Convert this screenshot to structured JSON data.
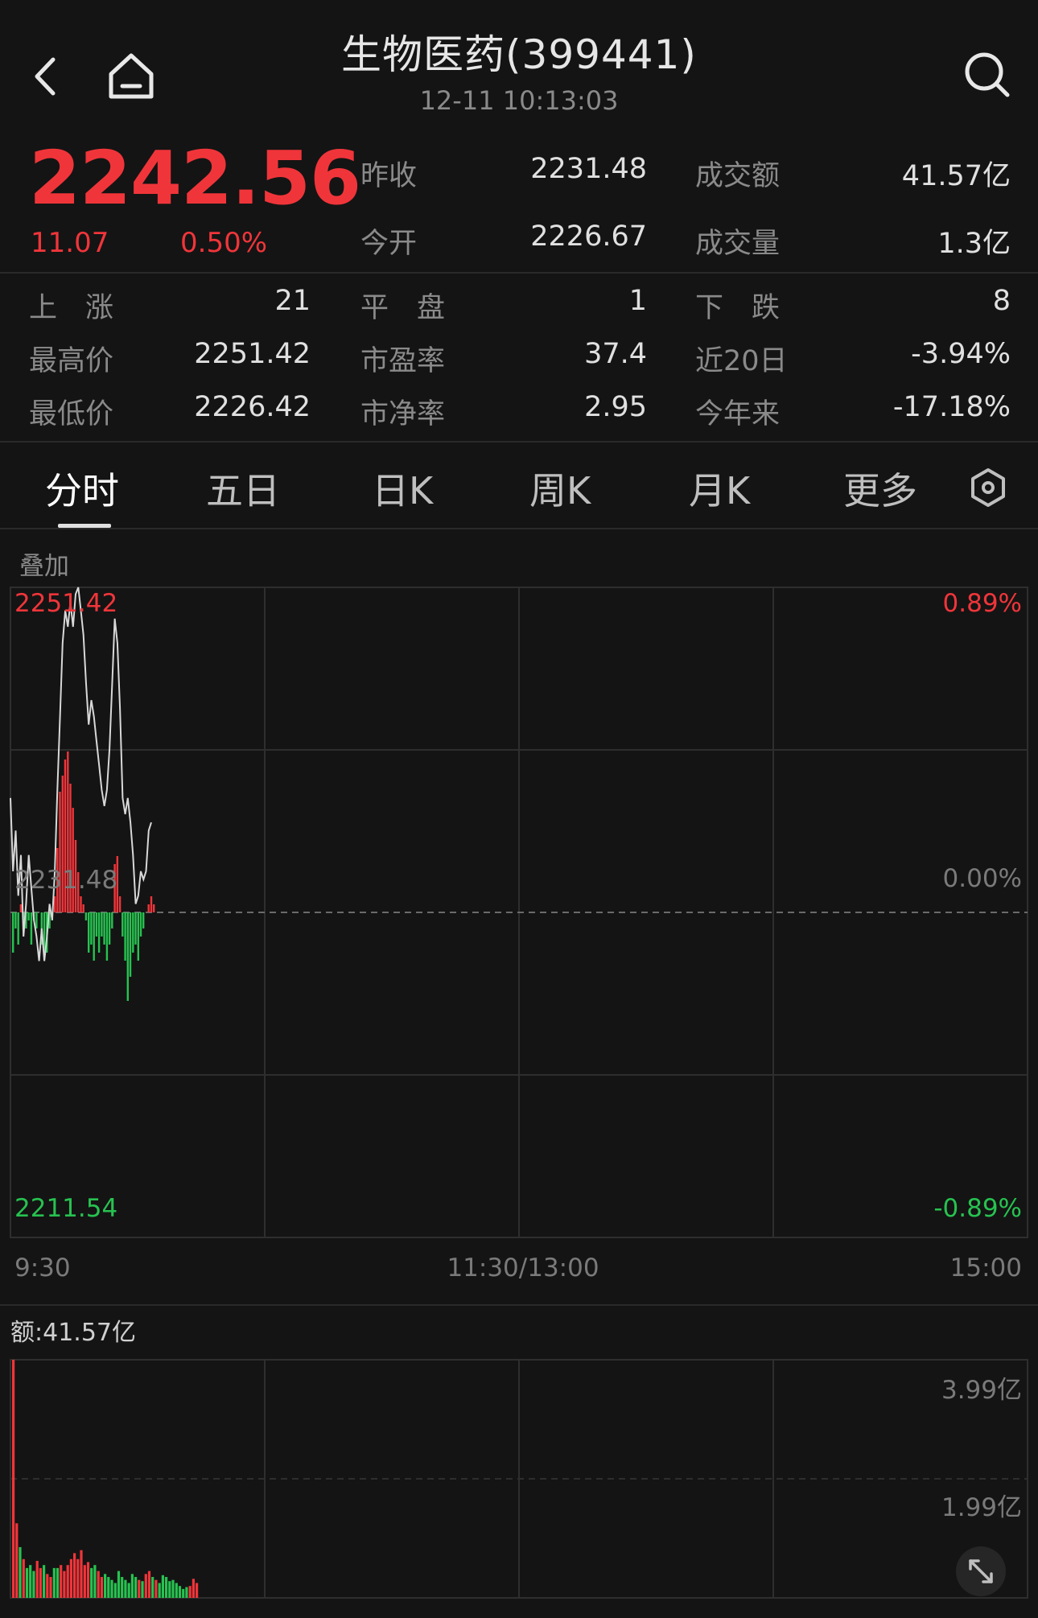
{
  "header": {
    "title": "生物医药(399441)",
    "timestamp": "12-11 10:13:03"
  },
  "quote": {
    "price": "2242.56",
    "change": "11.07",
    "change_pct": "0.50%",
    "color_up": "#f0353a",
    "color_down": "#27c250"
  },
  "stats_top": [
    {
      "label": "昨收",
      "value": "2231.48"
    },
    {
      "label": "成交额",
      "value": "41.57亿"
    },
    {
      "label": "今开",
      "value": "2226.67"
    },
    {
      "label": "成交量",
      "value": "1.3亿"
    }
  ],
  "stats_grid": [
    [
      {
        "label": "上　涨",
        "value": "21"
      },
      {
        "label": "平　盘",
        "value": "1"
      },
      {
        "label": "下　跌",
        "value": "8"
      }
    ],
    [
      {
        "label": "最高价",
        "value": "2251.42"
      },
      {
        "label": "市盈率",
        "value": "37.4"
      },
      {
        "label": "近20日",
        "value": "-3.94%"
      }
    ],
    [
      {
        "label": "最低价",
        "value": "2226.42"
      },
      {
        "label": "市净率",
        "value": "2.95"
      },
      {
        "label": "今年来",
        "value": "-17.18%"
      }
    ]
  ],
  "tabs": [
    {
      "label": "分时",
      "active": true
    },
    {
      "label": "五日",
      "active": false
    },
    {
      "label": "日K",
      "active": false
    },
    {
      "label": "周K",
      "active": false
    },
    {
      "label": "月K",
      "active": false
    },
    {
      "label": "更多",
      "active": false
    }
  ],
  "overlay_label": "叠加",
  "chart_data": [
    {
      "type": "line",
      "x_ticks": [
        "9:30",
        "11:30/13:00",
        "15:00"
      ],
      "ylim": [
        2211.54,
        2251.42
      ],
      "y_left_labels": {
        "top": "2251.42",
        "middle": "2231.48",
        "bottom": "2211.54"
      },
      "y_right_labels": {
        "top": "0.89%",
        "middle": "0.00%",
        "bottom": "-0.89%"
      },
      "reference": 2231.48,
      "total_minutes": 240,
      "series": [
        {
          "values": [
            2238.5,
            2234.0,
            2236.5,
            2232.5,
            2235.0,
            2230.0,
            2232.0,
            2235.0,
            2233.0,
            2231.0,
            2230.0,
            2228.5,
            2230.5,
            2228.5,
            2230.0,
            2232.0,
            2231.0,
            2234.0,
            2239.0,
            2243.5,
            2248.0,
            2250.0,
            2249.0,
            2250.5,
            2249.0,
            2251.0,
            2251.42,
            2250.0,
            2248.5,
            2245.5,
            2243.0,
            2244.5,
            2243.5,
            2242.0,
            2240.5,
            2239.0,
            2238.0,
            2239.0,
            2241.5,
            2245.5,
            2249.5,
            2248.0,
            2244.0,
            2238.5,
            2237.5,
            2238.5,
            2237.0,
            2235.0,
            2232.0,
            2232.5,
            2234.0,
            2233.5,
            2234.0,
            2236.5,
            2237.0
          ]
        },
        {
          "name": "bar_delta",
          "values": [
            -5,
            -2,
            -4,
            1,
            -2,
            -2,
            -1,
            -4,
            -1,
            -2,
            0,
            -4,
            -5,
            -5,
            -2,
            -1,
            2,
            8,
            15,
            17,
            19,
            20,
            16,
            13,
            9,
            5,
            2,
            1,
            -1,
            -5,
            -4,
            -6,
            -3,
            -5,
            -3,
            -4,
            -6,
            -4,
            -2,
            6,
            7,
            2,
            -3,
            -6,
            -11,
            -8,
            -5,
            -4,
            -6,
            -3,
            -2,
            0,
            1,
            2,
            1
          ]
        }
      ]
    },
    {
      "type": "bar",
      "title": "额:41.57亿",
      "y_labels": {
        "top": "3.99亿",
        "middle": "1.99亿"
      },
      "ylim": [
        0,
        3.99
      ],
      "unit": "亿",
      "values": [
        3.99,
        1.25,
        0.85,
        0.65,
        0.5,
        0.55,
        0.45,
        0.62,
        0.5,
        0.55,
        0.4,
        0.35,
        0.5,
        0.5,
        0.55,
        0.45,
        0.55,
        0.65,
        0.75,
        0.65,
        0.8,
        0.55,
        0.6,
        0.5,
        0.55,
        0.45,
        0.35,
        0.4,
        0.35,
        0.3,
        0.25,
        0.45,
        0.35,
        0.3,
        0.25,
        0.4,
        0.35,
        0.3,
        0.28,
        0.4,
        0.45,
        0.35,
        0.3,
        0.25,
        0.38,
        0.35,
        0.28,
        0.3,
        0.25,
        0.2,
        0.15,
        0.18,
        0.2,
        0.32,
        0.25
      ],
      "colors": [
        "red",
        "red",
        "green",
        "red",
        "green",
        "green",
        "green",
        "red",
        "red",
        "green",
        "red",
        "red",
        "green",
        "green",
        "red",
        "red",
        "red",
        "red",
        "red",
        "red",
        "red",
        "red",
        "red",
        "green",
        "green",
        "red",
        "red",
        "green",
        "green",
        "green",
        "green",
        "green",
        "green",
        "green",
        "green",
        "green",
        "green",
        "red",
        "green",
        "red",
        "red",
        "green",
        "red",
        "green",
        "green",
        "green",
        "green",
        "green",
        "green",
        "green",
        "green",
        "green",
        "red",
        "red",
        "red"
      ]
    }
  ]
}
